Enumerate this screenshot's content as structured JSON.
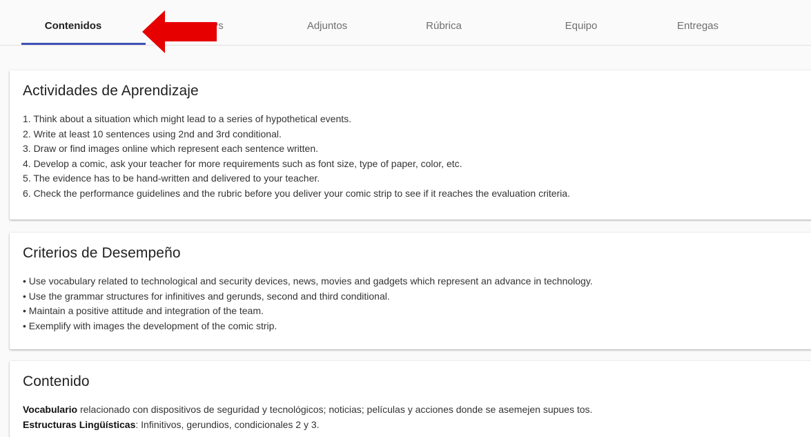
{
  "tabs": [
    {
      "label": "Contenidos",
      "active": true
    },
    {
      "label": "Ps"
    },
    {
      "label": "Adjuntos"
    },
    {
      "label": "Rúbrica"
    },
    {
      "label": "Equipo"
    },
    {
      "label": "Entregas"
    }
  ],
  "annotation": {
    "arrow_color": "#e60000"
  },
  "accent_color": "#3f51b5",
  "sections": {
    "actividades": {
      "title": "Actividades de Aprendizaje",
      "lines": [
        "1. Think about a situation which might lead to a series of hypothetical events.",
        "2. Write at least 10 sentences using 2nd and 3rd conditional.",
        "3. Draw or find images online which represent each sentence written.",
        "4. Develop a comic, ask your teacher for more requirements such as font size, type of paper, color, etc.",
        "5. The evidence has to be hand-written and delivered to your teacher.",
        "6. Check the performance guidelines and the rubric before you deliver your comic strip to see if it reaches the evaluation criteria."
      ]
    },
    "criterios": {
      "title": "Criterios de Desempeño",
      "lines": [
        "• Use vocabulary related to technological and security devices, news, movies and gadgets which represent an advance in technology.",
        "• Use the grammar structures for infinitives and gerunds, second and third conditional.",
        "• Maintain a positive attitude and integration of the team.",
        "• Exemplify with images the development of the comic strip."
      ]
    },
    "contenido": {
      "title": "Contenido",
      "vocab_label": "Vocabulario",
      "vocab_text": " relacionado con dispositivos de seguridad y tecnológicos; noticias; películas y acciones donde se asemejen supues tos.",
      "estructuras_label": "Estructuras Lingüísticas",
      "estructuras_text": ": Infinitivos, gerundios, condicionales 2 y 3."
    }
  }
}
